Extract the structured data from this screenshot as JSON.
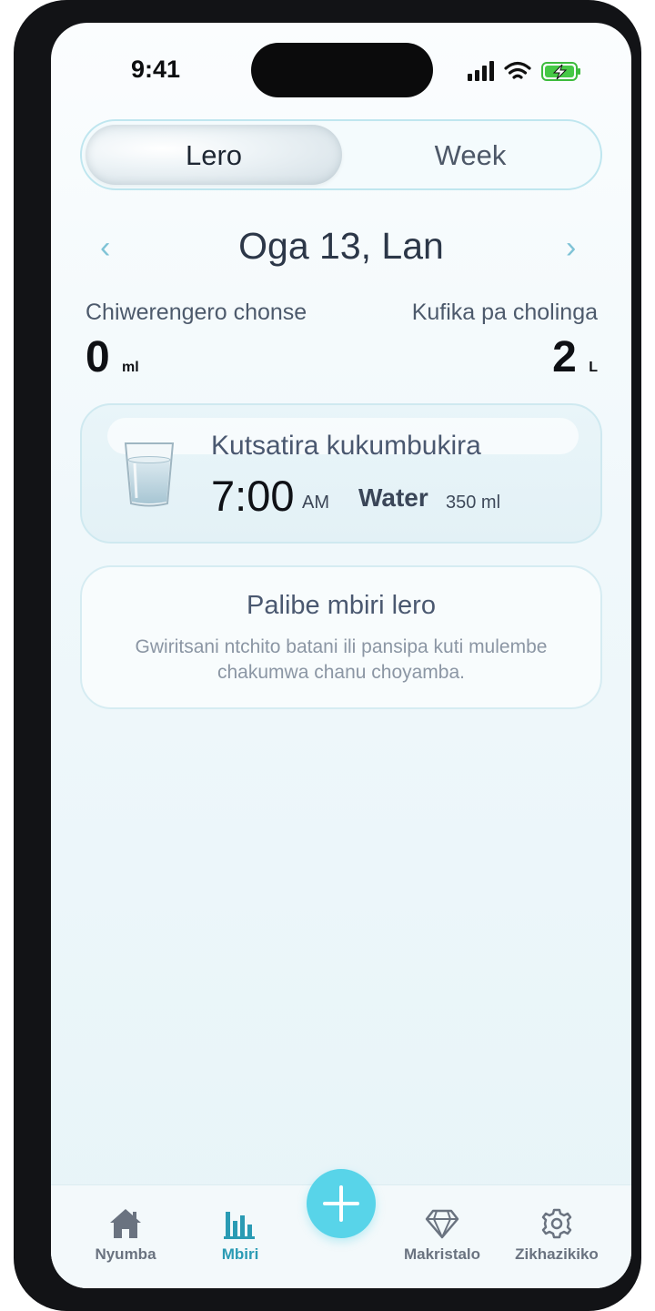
{
  "status_bar": {
    "time": "9:41"
  },
  "segmented": {
    "active": "Lero",
    "inactive": "Week"
  },
  "date_nav": {
    "title": "Oga 13, Lan"
  },
  "stats": {
    "total_label": "Chiwerengero chonse",
    "total_value": "0",
    "total_unit": "ml",
    "goal_label": "Kufika pa cholinga",
    "goal_value": "2",
    "goal_unit": "L"
  },
  "reminder": {
    "title": "Kutsatira kukumbukira",
    "time": "7:00",
    "ampm": "AM",
    "drink": "Water",
    "amount": "350 ml"
  },
  "empty_state": {
    "title": "Palibe mbiri lero",
    "subtitle": "Gwiritsani ntchito batani ili pansipa kuti mulembe chakumwa chanu choyamba."
  },
  "tabbar": {
    "items": [
      {
        "label": "Nyumba",
        "icon": "home-icon"
      },
      {
        "label": "Mbiri",
        "icon": "bar-chart-icon"
      },
      {
        "label": "Makristalo",
        "icon": "diamond-icon"
      },
      {
        "label": "Zikhazikiko",
        "icon": "gear-icon"
      }
    ],
    "active_index": 1,
    "fab_icon": "plus-icon"
  },
  "colors": {
    "accent": "#58d4e9",
    "active_tab": "#2a9bb4"
  }
}
